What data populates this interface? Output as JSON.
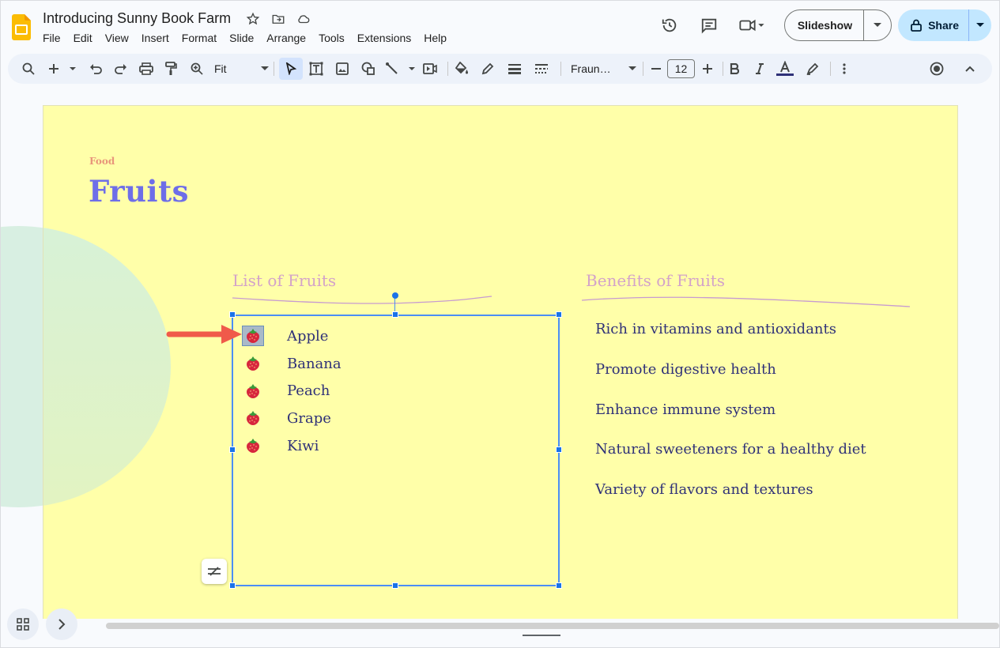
{
  "app": {
    "title": "Introducing Sunny Book Farm",
    "menu": [
      "File",
      "Edit",
      "View",
      "Insert",
      "Format",
      "Slide",
      "Arrange",
      "Tools",
      "Extensions",
      "Help"
    ],
    "slideshow_label": "Slideshow",
    "share_label": "Share",
    "brand_color": "#fbbc04",
    "accent_color": "#1a73e8"
  },
  "toolbar": {
    "zoom_value": "Fit",
    "font_name": "Fraun…",
    "font_size": "12",
    "icons": [
      "search-icon",
      "new-slide-icon",
      "undo-icon",
      "redo-icon",
      "print-icon",
      "paint-format-icon",
      "zoom-icon",
      "select-icon",
      "text-box-icon",
      "image-icon",
      "shape-icon",
      "line-icon",
      "video-icon",
      "fill-color-icon",
      "border-color-icon",
      "border-weight-icon",
      "border-dash-icon",
      "bold-icon",
      "italic-icon",
      "text-color-icon",
      "highlight-icon",
      "more-icon",
      "record-icon",
      "collapse-icon"
    ]
  },
  "slide": {
    "background": "#ffffa9",
    "kicker": "Food",
    "title": "Fruits",
    "left_heading": "List of Fruits",
    "right_heading": "Benefits of Fruits",
    "fruits": [
      "Apple",
      "Banana",
      "Peach",
      "Grape",
      "Kiwi"
    ],
    "benefits": [
      "Rich in vitamins and antioxidants",
      "Promote digestive health",
      "Enhance immune system",
      "Natural sweeteners for a healthy diet",
      "Variety of flavors and textures"
    ]
  }
}
